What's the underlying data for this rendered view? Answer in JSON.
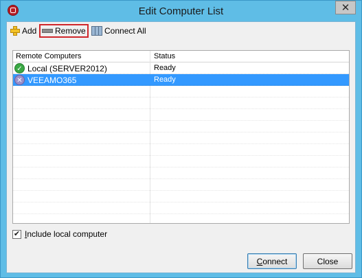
{
  "window": {
    "title": "Edit Computer List",
    "close_glyph": "✕"
  },
  "toolbar": {
    "add_label": "Add",
    "remove_label": "Remove",
    "connect_all_label": "Connect All"
  },
  "list": {
    "columns": [
      "Remote Computers",
      "Status"
    ],
    "rows": [
      {
        "name": "Local (SERVER2012)",
        "status": "Ready",
        "icon": "check-icon",
        "selected": false
      },
      {
        "name": "VEEAMO365",
        "status": "Ready",
        "icon": "x-circle-icon",
        "selected": true
      }
    ]
  },
  "options": {
    "include_local_label": "Include local computer",
    "include_local_checked": true
  },
  "buttons": {
    "connect_label": "Connect",
    "close_label": "Close"
  },
  "colors": {
    "title_bar": "#5fbde6",
    "selection": "#3399ff",
    "highlight_border": "#d0262a"
  }
}
